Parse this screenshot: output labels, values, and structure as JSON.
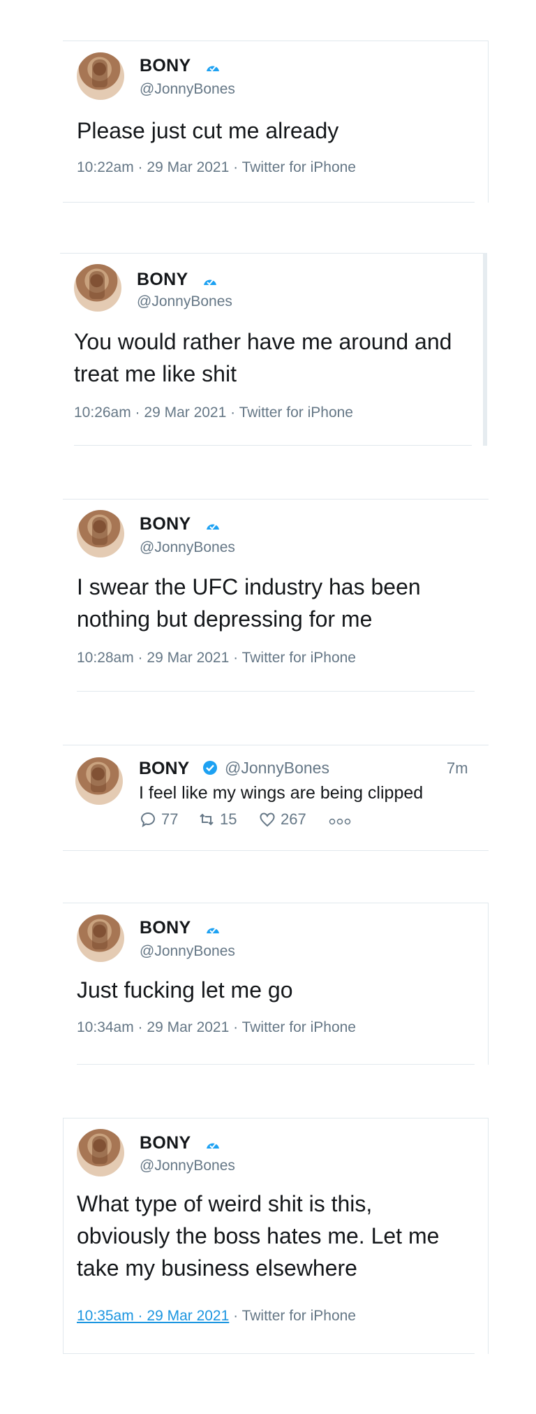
{
  "tweets": [
    {
      "name": "BONY",
      "handle": "@JonnyBones",
      "text": "Please just cut me already",
      "meta": "10:22am · 29 Mar 2021 · Twitter for iPhone"
    },
    {
      "name": "BONY",
      "handle": "@JonnyBones",
      "text": "You would rather have me around and treat me like shit",
      "meta": "10:26am · 29 Mar 2021 · Twitter for iPhone"
    },
    {
      "name": "BONY",
      "handle": "@JonnyBones",
      "text": "I swear the UFC industry has been nothing but depressing for me",
      "meta": "10:28am · 29 Mar 2021 · Twitter for iPhone"
    },
    {
      "name": "BONY",
      "handle": "@JonnyBones",
      "text": "Just fucking let me go",
      "meta": "10:34am · 29 Mar 2021 · Twitter for iPhone"
    },
    {
      "name": "BONY",
      "handle": "@JonnyBones",
      "text": "What type of weird shit is this, obviously the boss hates me. Let me take my business elsewhere",
      "meta_link": "10:35am · 29 Mar 2021",
      "meta_rest": " · Twitter for iPhone"
    }
  ],
  "compact_tweet": {
    "name": "BONY",
    "handle": "@JonnyBones",
    "time": "7m",
    "text": "I feel like my wings are being clipped",
    "replies": "77",
    "retweets": "15",
    "likes": "267"
  },
  "icons": {
    "verified": "verified-badge-icon",
    "reply": "reply-icon",
    "retweet": "retweet-icon",
    "like": "heart-icon",
    "more": "more-icon"
  },
  "colors": {
    "accent": "#1da1f2",
    "secondary_text": "#657786",
    "border": "#e1e8ed"
  }
}
